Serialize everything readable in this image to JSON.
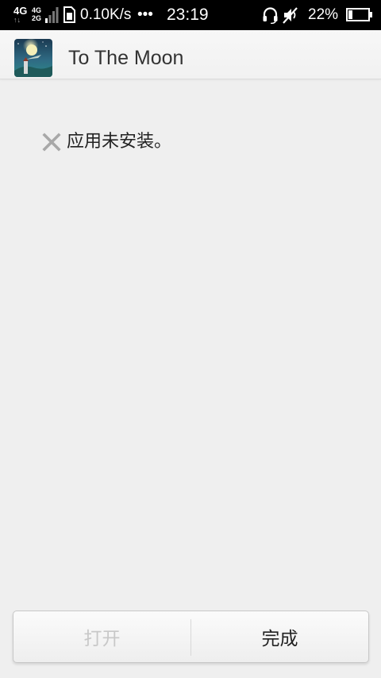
{
  "status_bar": {
    "network_primary": "4G",
    "network_primary_arrows": "↑↓",
    "network_secondary_top": "4G",
    "network_secondary_bottom": "2G",
    "speed": "0.10K/s",
    "more": "•••",
    "time": "23:19",
    "battery_percent": "22%",
    "battery_level": 0.22,
    "icons": [
      "signal-icon",
      "sim-card-icon",
      "headset-icon",
      "mute-icon",
      "battery-icon"
    ]
  },
  "header": {
    "app_name": "To The Moon",
    "icon": "app-icon"
  },
  "result": {
    "icon": "fail-icon",
    "message": "应用未安装。"
  },
  "buttons": {
    "open_label": "打开",
    "done_label": "完成"
  },
  "colors": {
    "background": "#efefef",
    "status_bar": "#000000",
    "disabled_text": "#c8c8c8",
    "fail_icon": "#a8a8a8"
  }
}
